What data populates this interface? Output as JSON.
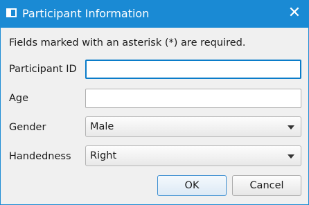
{
  "window": {
    "title": "Participant Information",
    "close_symbol": "✕"
  },
  "form": {
    "instructions": "Fields marked with an asterisk (*) are required.",
    "participant_id": {
      "label": "Participant ID",
      "value": ""
    },
    "age": {
      "label": "Age",
      "value": ""
    },
    "gender": {
      "label": "Gender",
      "selected": "Male"
    },
    "handedness": {
      "label": "Handedness",
      "selected": "Right"
    }
  },
  "buttons": {
    "ok": "OK",
    "cancel": "Cancel"
  },
  "colors": {
    "titlebar": "#1a8ad4",
    "focus_border": "#0a7cc9",
    "background": "#f0f0f0"
  },
  "icons": {
    "window_icon": "window-icon",
    "close_icon": "close-icon",
    "dropdown_icon": "chevron-down-icon"
  }
}
